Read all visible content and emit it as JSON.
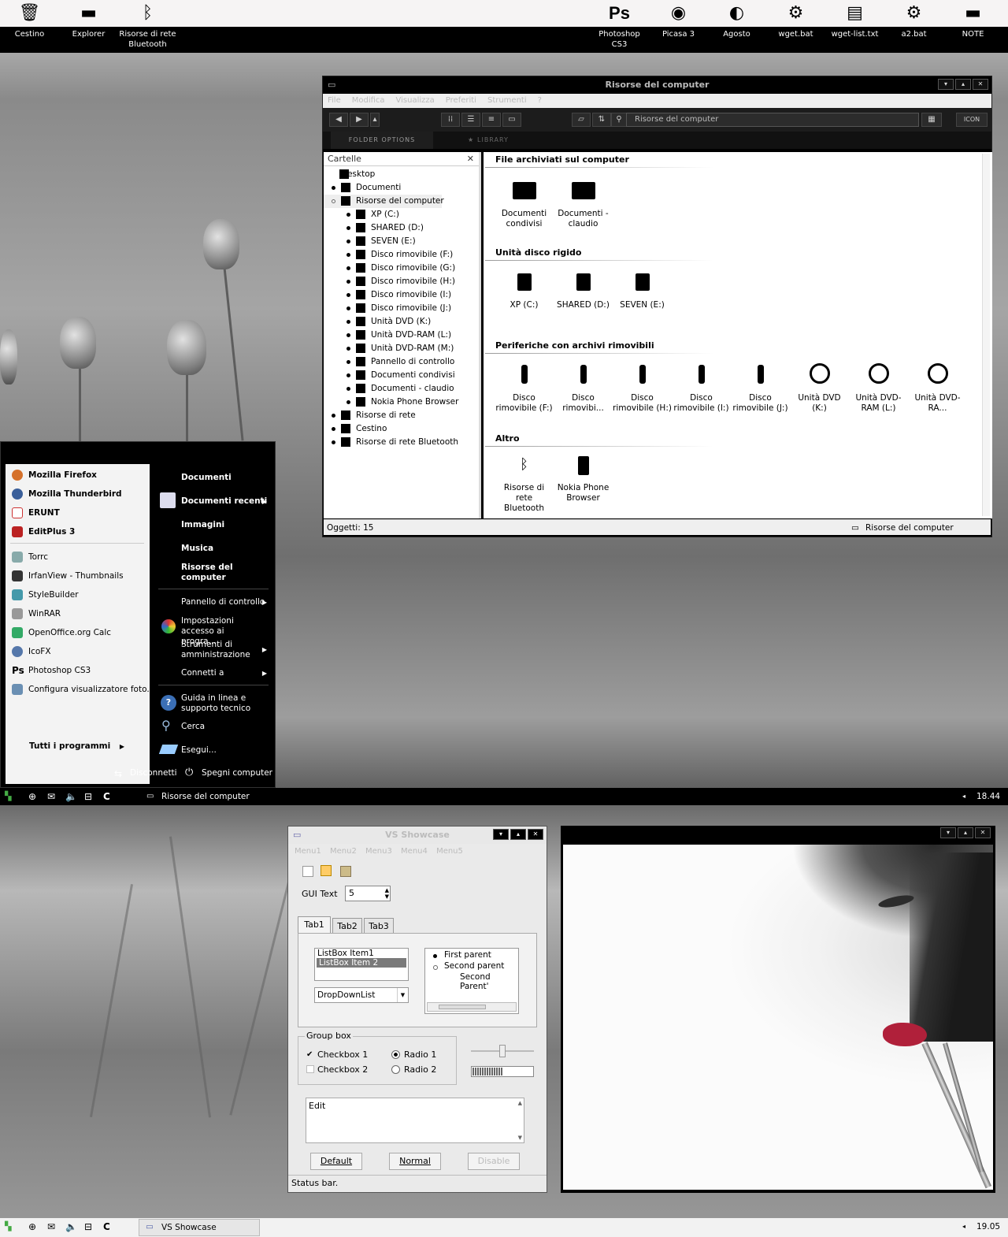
{
  "desktop_top": [
    {
      "label": "Cestino",
      "icon": "recycle-bin-icon"
    },
    {
      "label": "Explorer",
      "icon": "folder-window-icon"
    },
    {
      "label": "Risorse di rete Bluetooth",
      "icon": "bluetooth-icon"
    },
    {
      "label": "Photoshop CS3",
      "icon": "photoshop-icon"
    },
    {
      "label": "Picasa 3",
      "icon": "picasa-icon"
    },
    {
      "label": "Agosto",
      "icon": "agosto-icon"
    },
    {
      "label": "wget.bat",
      "icon": "batch-file-icon"
    },
    {
      "label": "wget-list.txt",
      "icon": "text-file-icon"
    },
    {
      "label": "a2.bat",
      "icon": "batch-file-icon"
    },
    {
      "label": "NOTE",
      "icon": "folder-icon"
    }
  ],
  "explorer": {
    "title": "Risorse del computer",
    "menu": [
      "File",
      "Modifica",
      "Visualizza",
      "Preferiti",
      "Strumenti",
      "?"
    ],
    "address": "Risorse del computer",
    "view_label": "ICON",
    "tab_folder_options": "FOLDER OPTIONS",
    "tab_library": "LIBRARY",
    "folders_header": "Cartelle",
    "tree": [
      {
        "label": "Desktop",
        "level": 0
      },
      {
        "label": "Documenti",
        "level": 1
      },
      {
        "label": "Risorse del computer",
        "level": 1
      },
      {
        "label": "XP (C:)",
        "level": 2
      },
      {
        "label": "SHARED (D:)",
        "level": 2
      },
      {
        "label": "SEVEN (E:)",
        "level": 2
      },
      {
        "label": "Disco rimovibile (F:)",
        "level": 2
      },
      {
        "label": "Disco rimovibile (G:)",
        "level": 2
      },
      {
        "label": "Disco rimovibile (H:)",
        "level": 2
      },
      {
        "label": "Disco rimovibile (I:)",
        "level": 2
      },
      {
        "label": "Disco rimovibile (J:)",
        "level": 2
      },
      {
        "label": "Unità DVD (K:)",
        "level": 2
      },
      {
        "label": "Unità DVD-RAM (L:)",
        "level": 2
      },
      {
        "label": "Unità DVD-RAM (M:)",
        "level": 2
      },
      {
        "label": "Pannello di controllo",
        "level": 2
      },
      {
        "label": "Documenti condivisi",
        "level": 2
      },
      {
        "label": "Documenti - claudio",
        "level": 2
      },
      {
        "label": "Nokia Phone Browser",
        "level": 2
      },
      {
        "label": "Risorse di rete",
        "level": 1
      },
      {
        "label": "Cestino",
        "level": 1
      },
      {
        "label": "Risorse di rete Bluetooth",
        "level": 1
      }
    ],
    "sections": {
      "files": "File archiviati sul computer",
      "hdd": "Unità disco rigido",
      "removable": "Periferiche con archivi rimovibili",
      "other": "Altro"
    },
    "files": [
      "Documenti condivisi",
      "Documenti - claudio"
    ],
    "hdd": [
      "XP (C:)",
      "SHARED (D:)",
      "SEVEN (E:)"
    ],
    "removable": [
      "Disco rimovibile (F:)",
      "Disco rimovibi...",
      "Disco rimovibile (H:)",
      "Disco rimovibile (I:)",
      "Disco rimovibile (J:)",
      "Unità DVD (K:)",
      "Unità DVD-RAM (L:)",
      "Unità DVD-RA..."
    ],
    "other": [
      "Risorse di rete Bluetooth",
      "Nokia Phone Browser"
    ],
    "status_count": "Oggetti: 15",
    "status_location": "Risorse del computer"
  },
  "startmenu": {
    "pinned": [
      "Mozilla Firefox",
      "Mozilla Thunderbird",
      "ERUNT",
      "EditPlus 3"
    ],
    "recent": [
      "Torrc",
      "IrfanView - Thumbnails",
      "StyleBuilder",
      "WinRAR",
      "OpenOffice.org Calc",
      "IcoFX",
      "Photoshop CS3",
      "Configura visualizzatore foto..."
    ],
    "all_programs": "Tutti i programmi",
    "right": {
      "documenti": "Documenti",
      "recenti": "Documenti recenti",
      "immagini": "Immagini",
      "musica": "Musica",
      "computer": "Risorse del computer",
      "pannello": "Pannello di controllo",
      "impostazioni": "Impostazioni accesso ai progra...",
      "strumenti": "Strumenti di amministrazione",
      "connetti": "Connetti a",
      "guida": "Guida in linea e supporto tecnico",
      "cerca": "Cerca",
      "esegui": "Esegui..."
    },
    "logoff": "Disconnetti",
    "shutdown": "Spegni computer"
  },
  "taskbar1": {
    "task": "Risorse del computer",
    "clock": "18.44"
  },
  "taskbar2": {
    "task": "VS Showcase",
    "clock": "19.05"
  },
  "vs": {
    "title": "VS Showcase",
    "menus": [
      "Menu1",
      "Menu2",
      "Menu3",
      "Menu4",
      "Menu5"
    ],
    "gui_text_label": "GUI Text",
    "spin_value": "5",
    "tabs": [
      "Tab1",
      "Tab2",
      "Tab3"
    ],
    "listbox": [
      "ListBox Item1",
      "ListBox Item 2"
    ],
    "dropdown": "DropDownList",
    "tree": [
      "First parent",
      "Second parent",
      "Second Parent'"
    ],
    "groupbox": "Group box",
    "checkbox1": "Checkbox 1",
    "checkbox2": "Checkbox 2",
    "radio1": "Radio 1",
    "radio2": "Radio 2",
    "edit": "Edit",
    "btn_default": "Default",
    "btn_normal": "Normal",
    "btn_disable": "Disable",
    "status": "Status bar."
  },
  "colors": {
    "black": "#000000",
    "lip": "#b0203a",
    "selection": "#7a7a7a"
  }
}
